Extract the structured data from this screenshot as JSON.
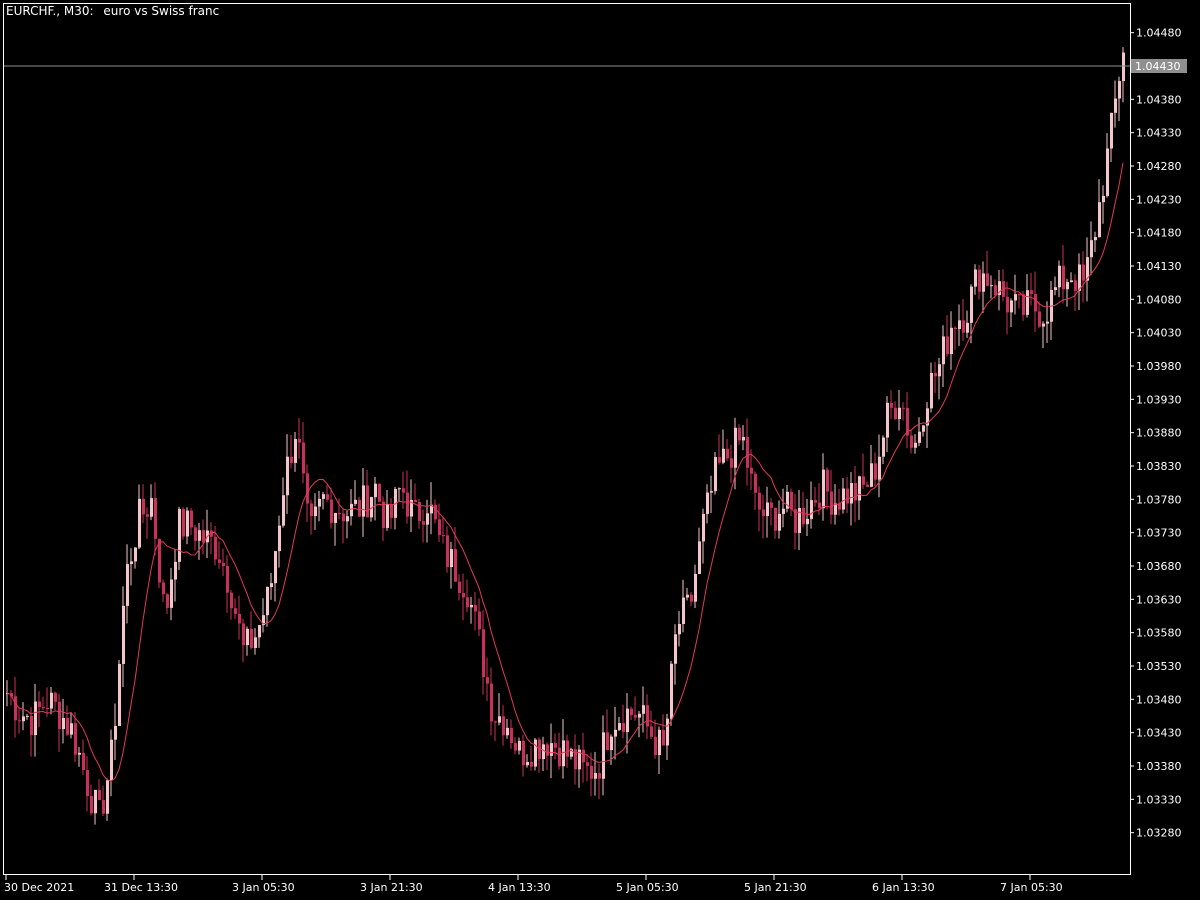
{
  "window": {
    "symbol_label": "EURCHF., M30:",
    "description": "euro vs Swiss franc"
  },
  "colors": {
    "background": "#000000",
    "frame": "#ffffff",
    "bull_candle": "#f4c6cc",
    "bear_candle": "#c8325a",
    "ma_line": "#e23a55",
    "price_line": "#8f8f8f",
    "price_tag_bg": "#8f8f8f",
    "green_candle": "#2bd32b"
  },
  "chart_data": {
    "type": "candlestick",
    "title": "EURCHF., M30:  euro vs Swiss franc",
    "current_price": 1.0443,
    "current_price_label": "1.04430",
    "ylim": [
      1.0323,
      1.0452
    ],
    "y_ticks": [
      "1.04480",
      "1.04430",
      "1.04380",
      "1.04330",
      "1.04280",
      "1.04230",
      "1.04180",
      "1.04130",
      "1.04080",
      "1.04030",
      "1.03980",
      "1.03930",
      "1.03880",
      "1.03830",
      "1.03780",
      "1.03730",
      "1.03680",
      "1.03630",
      "1.03580",
      "1.03530",
      "1.03480",
      "1.03430",
      "1.03380",
      "1.03330",
      "1.03280"
    ],
    "y_tick_values": [
      1.0448,
      1.0443,
      1.0438,
      1.0433,
      1.0428,
      1.0423,
      1.0418,
      1.0413,
      1.0408,
      1.0403,
      1.0398,
      1.0393,
      1.0388,
      1.0383,
      1.0378,
      1.0373,
      1.0368,
      1.0363,
      1.0358,
      1.0353,
      1.0348,
      1.0343,
      1.0338,
      1.0333,
      1.0328
    ],
    "x_ticks": [
      "30 Dec 2021",
      "31 Dec 13:30",
      "3 Jan 05:30",
      "3 Jan 21:30",
      "4 Jan 13:30",
      "5 Jan 05:30",
      "5 Jan 21:30",
      "6 Jan 13:30",
      "7 Jan 05:30"
    ],
    "x_tick_bar_index": [
      0,
      32,
      64,
      96,
      128,
      160,
      192,
      224,
      256
    ],
    "key_closes": [
      1.0349,
      1.0346,
      1.0345,
      1.0348,
      1.0346,
      1.0343,
      1.0336,
      1.033,
      1.034,
      1.0366,
      1.0375,
      1.0378,
      1.036,
      1.0374,
      1.0374,
      1.0372,
      1.0371,
      1.0365,
      1.0355,
      1.0358,
      1.0364,
      1.038,
      1.0389,
      1.0372,
      1.0378,
      1.0377,
      1.0376,
      1.0377,
      1.038,
      1.0374,
      1.038,
      1.0375,
      1.0378,
      1.0371,
      1.0368,
      1.0365,
      1.0356,
      1.0346,
      1.0345,
      1.034,
      1.0341,
      1.0342,
      1.0341,
      1.0339,
      1.0337,
      1.0338,
      1.0345,
      1.0346,
      1.0346,
      1.0343,
      1.034,
      1.0359,
      1.0362,
      1.0374,
      1.0382,
      1.0385,
      1.0387,
      1.0377,
      1.0375,
      1.0377,
      1.0375,
      1.0377,
      1.038,
      1.0378,
      1.0379,
      1.0379,
      1.0382,
      1.039,
      1.0394,
      1.0385,
      1.0394,
      1.0398,
      1.0405,
      1.0406,
      1.0412,
      1.0411,
      1.0408,
      1.0406,
      1.0407,
      1.0406,
      1.041,
      1.0412,
      1.041,
      1.042,
      1.0432,
      1.0446
    ]
  }
}
